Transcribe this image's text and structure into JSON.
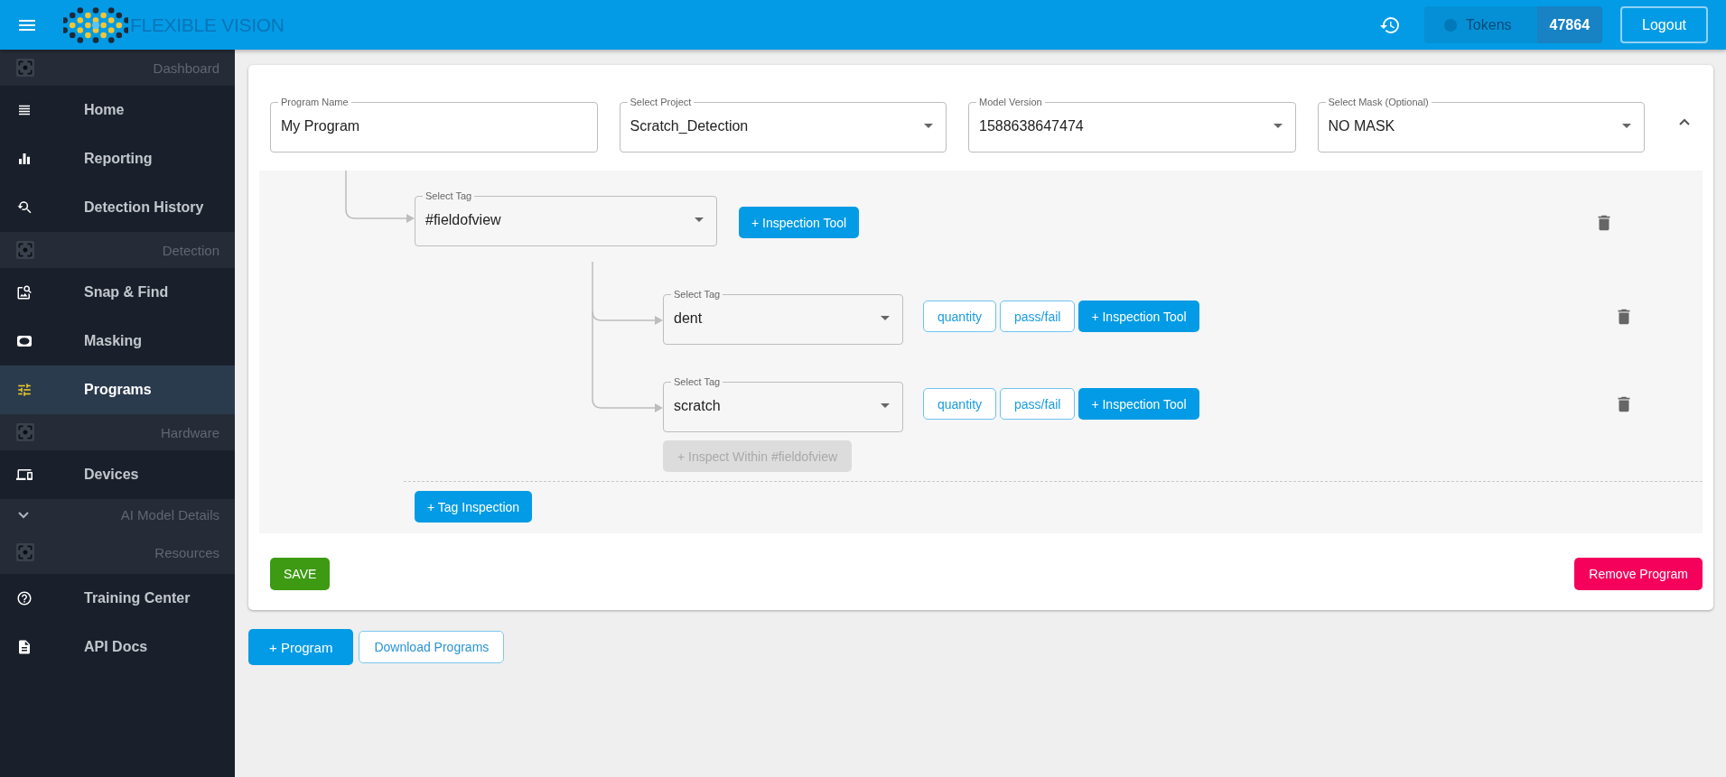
{
  "header": {
    "title": "FLEXIBLE VISION",
    "tokens_label": "Tokens",
    "tokens_value": "47864",
    "logout": "Logout"
  },
  "sidebar": {
    "items": [
      {
        "kind": "section",
        "label": "Dashboard"
      },
      {
        "kind": "link",
        "label": "Home",
        "selected": false
      },
      {
        "kind": "link",
        "label": "Reporting",
        "selected": false
      },
      {
        "kind": "link",
        "label": "Detection History",
        "selected": false
      },
      {
        "kind": "section",
        "label": "Detection"
      },
      {
        "kind": "link",
        "label": "Snap & Find",
        "selected": false
      },
      {
        "kind": "link",
        "label": "Masking",
        "selected": false
      },
      {
        "kind": "link",
        "label": "Programs",
        "selected": true
      },
      {
        "kind": "section",
        "label": "Hardware"
      },
      {
        "kind": "link",
        "label": "Devices",
        "selected": false
      },
      {
        "kind": "expander",
        "label": "AI Model Details",
        "expanded": false
      },
      {
        "kind": "section",
        "label": "Resources"
      },
      {
        "kind": "link",
        "label": "Training Center",
        "selected": false
      },
      {
        "kind": "link",
        "label": "API Docs",
        "selected": false
      }
    ]
  },
  "program": {
    "fields": [
      {
        "kind": "text",
        "label": "Program Name",
        "value": "My Program"
      },
      {
        "kind": "select",
        "label": "Select Project",
        "value": "Scratch_Detection"
      },
      {
        "kind": "select",
        "label": "Model Version",
        "value": "1588638647474"
      },
      {
        "kind": "select",
        "label": "Select Mask (Optional)",
        "value": "NO MASK"
      }
    ],
    "expanded": true,
    "tree": {
      "tag": {
        "label": "Select Tag",
        "value": "#fieldofview"
      },
      "tool_button": "+ Inspection Tool",
      "children": [
        {
          "label": "Select Tag",
          "value": "dent",
          "chips": [
            "quantity",
            "pass/fail"
          ],
          "tool_button": "+ Inspection Tool"
        },
        {
          "label": "Select Tag",
          "value": "scratch",
          "chips": [
            "quantity",
            "pass/fail"
          ],
          "tool_button": "+ Inspection Tool"
        }
      ],
      "inspect_within": {
        "label": "+ Inspect Within #fieldofview",
        "disabled": true
      },
      "add_tag_button": "+ Tag Inspection"
    },
    "save": "SAVE",
    "remove": "Remove Program"
  },
  "footer": {
    "add_program": "+ Program",
    "download": "Download Programs"
  }
}
